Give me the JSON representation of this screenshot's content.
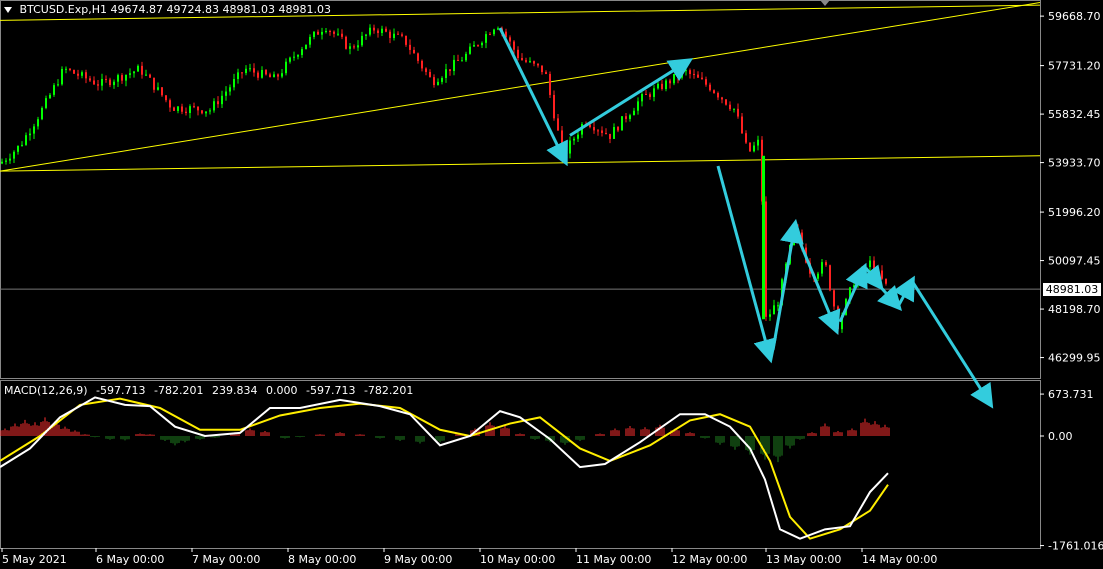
{
  "header": {
    "symbol": "BTCUSD.Exp,H1",
    "open": "49674.87",
    "high": "49724.83",
    "low": "48981.03",
    "close": "48981.03"
  },
  "current_price": "48981.03",
  "macd_header": {
    "name": "MACD(12,26,9)",
    "values": [
      "-597.713",
      "-782.201",
      "239.834",
      "0.000",
      "-597.713",
      "-782.201"
    ]
  },
  "colors": {
    "background": "#000000",
    "bull": "#00ff00",
    "bear": "#ff2020",
    "trendline": "#ffff00",
    "arrow": "#33ccdd",
    "macd_line": "#ffffff",
    "signal_line": "#ffee00",
    "hist_pos": "#ff3030",
    "hist_neg": "#208020",
    "grid_border": "#ffffff"
  },
  "chart_data": [
    {
      "type": "candlestick",
      "title": "BTCUSD.Exp,H1",
      "ylim": [
        45500,
        60300
      ],
      "y_ticks": [
        59668.7,
        57731.2,
        55832.45,
        53933.7,
        51996.2,
        50097.45,
        48198.7,
        46299.95
      ],
      "x_ticks": [
        "5 May 2021",
        "6 May 00:00",
        "7 May 00:00",
        "8 May 00:00",
        "9 May 00:00",
        "10 May 00:00",
        "11 May 00:00",
        "12 May 00:00",
        "13 May 00:00",
        "14 May 00:00"
      ],
      "price_path": [
        {
          "x": 0,
          "y": 53900
        },
        {
          "x": 20,
          "y": 54600
        },
        {
          "x": 45,
          "y": 56200
        },
        {
          "x": 64,
          "y": 57600
        },
        {
          "x": 100,
          "y": 57000
        },
        {
          "x": 140,
          "y": 57600
        },
        {
          "x": 172,
          "y": 56100
        },
        {
          "x": 210,
          "y": 56000
        },
        {
          "x": 245,
          "y": 57600
        },
        {
          "x": 275,
          "y": 57200
        },
        {
          "x": 300,
          "y": 58400
        },
        {
          "x": 325,
          "y": 59300
        },
        {
          "x": 350,
          "y": 58400
        },
        {
          "x": 375,
          "y": 59200
        },
        {
          "x": 405,
          "y": 58700
        },
        {
          "x": 432,
          "y": 57100
        },
        {
          "x": 465,
          "y": 58100
        },
        {
          "x": 497,
          "y": 59400
        },
        {
          "x": 520,
          "y": 58000
        },
        {
          "x": 545,
          "y": 57500
        },
        {
          "x": 563,
          "y": 54200
        },
        {
          "x": 585,
          "y": 55600
        },
        {
          "x": 610,
          "y": 55000
        },
        {
          "x": 640,
          "y": 56400
        },
        {
          "x": 685,
          "y": 57500
        },
        {
          "x": 710,
          "y": 56900
        },
        {
          "x": 735,
          "y": 56000
        },
        {
          "x": 748,
          "y": 54300
        },
        {
          "x": 760,
          "y": 54800
        },
        {
          "x": 766,
          "y": 47800
        },
        {
          "x": 778,
          "y": 48500
        },
        {
          "x": 795,
          "y": 51400
        },
        {
          "x": 812,
          "y": 49500
        },
        {
          "x": 825,
          "y": 50000
        },
        {
          "x": 838,
          "y": 47600
        },
        {
          "x": 855,
          "y": 49400
        },
        {
          "x": 870,
          "y": 50000
        },
        {
          "x": 888,
          "y": 48981
        }
      ],
      "trendlines": [
        {
          "x1": 0,
          "y1": 59500,
          "x2": 1040,
          "y2": 60100
        },
        {
          "x1": 0,
          "y1": 53600,
          "x2": 1040,
          "y2": 60200
        },
        {
          "x1": 0,
          "y1": 53600,
          "x2": 1040,
          "y2": 54200
        }
      ],
      "arrows": [
        {
          "x1": 500,
          "y1": 59200,
          "x2": 565,
          "y2": 54000
        },
        {
          "x1": 570,
          "y1": 55000,
          "x2": 688,
          "y2": 57900
        },
        {
          "x1": 718,
          "y1": 53800,
          "x2": 770,
          "y2": 46300
        },
        {
          "x1": 773,
          "y1": 46600,
          "x2": 795,
          "y2": 51500
        },
        {
          "x1": 798,
          "y1": 51000,
          "x2": 836,
          "y2": 47400
        },
        {
          "x1": 840,
          "y1": 47700,
          "x2": 864,
          "y2": 49800
        },
        {
          "x1": 866,
          "y1": 49800,
          "x2": 880,
          "y2": 49100
        },
        {
          "x1": 882,
          "y1": 49000,
          "x2": 898,
          "y2": 48300
        },
        {
          "x1": 898,
          "y1": 48300,
          "x2": 912,
          "y2": 49300
        },
        {
          "x1": 912,
          "y1": 49300,
          "x2": 990,
          "y2": 44500
        }
      ]
    },
    {
      "type": "line",
      "title": "MACD(12,26,9)",
      "ylim": [
        -1800,
        900
      ],
      "y_ticks": [
        673.731,
        0.0,
        -1761.016
      ],
      "series": [
        {
          "values_xy": [
            [
              0,
              -500
            ],
            [
              30,
              -200
            ],
            [
              60,
              300
            ],
            [
              95,
              620
            ],
            [
              125,
              500
            ],
            [
              150,
              480
            ],
            [
              175,
              150
            ],
            [
              205,
              0
            ],
            [
              240,
              50
            ],
            [
              270,
              450
            ],
            [
              300,
              450
            ],
            [
              340,
              580
            ],
            [
              380,
              480
            ],
            [
              410,
              350
            ],
            [
              440,
              -150
            ],
            [
              470,
              0
            ],
            [
              500,
              400
            ],
            [
              520,
              300
            ],
            [
              550,
              -50
            ],
            [
              580,
              -500
            ],
            [
              605,
              -450
            ],
            [
              640,
              -100
            ],
            [
              680,
              350
            ],
            [
              705,
              350
            ],
            [
              730,
              150
            ],
            [
              750,
              -200
            ],
            [
              765,
              -700
            ],
            [
              780,
              -1500
            ],
            [
              800,
              -1650
            ],
            [
              825,
              -1500
            ],
            [
              850,
              -1450
            ],
            [
              870,
              -900
            ],
            [
              888,
              -597.713
            ]
          ]
        },
        {
          "values_xy": [
            [
              0,
              -400
            ],
            [
              40,
              0
            ],
            [
              80,
              500
            ],
            [
              120,
              600
            ],
            [
              160,
              450
            ],
            [
              200,
              100
            ],
            [
              240,
              100
            ],
            [
              280,
              330
            ],
            [
              320,
              450
            ],
            [
              360,
              520
            ],
            [
              400,
              450
            ],
            [
              440,
              100
            ],
            [
              470,
              0
            ],
            [
              510,
              200
            ],
            [
              540,
              300
            ],
            [
              580,
              -200
            ],
            [
              610,
              -400
            ],
            [
              650,
              -150
            ],
            [
              690,
              250
            ],
            [
              720,
              350
            ],
            [
              750,
              150
            ],
            [
              770,
              -400
            ],
            [
              790,
              -1300
            ],
            [
              810,
              -1650
            ],
            [
              840,
              -1500
            ],
            [
              870,
              -1200
            ],
            [
              888,
              -782.201
            ]
          ]
        }
      ],
      "histogram": [
        {
          "x": 5,
          "v": 120
        },
        {
          "x": 15,
          "v": 200
        },
        {
          "x": 25,
          "v": 260
        },
        {
          "x": 35,
          "v": 220
        },
        {
          "x": 45,
          "v": 300
        },
        {
          "x": 55,
          "v": 240
        },
        {
          "x": 65,
          "v": 150
        },
        {
          "x": 75,
          "v": 90
        },
        {
          "x": 85,
          "v": 30
        },
        {
          "x": 95,
          "v": -20
        },
        {
          "x": 110,
          "v": -60
        },
        {
          "x": 125,
          "v": -70
        },
        {
          "x": 140,
          "v": 40
        },
        {
          "x": 150,
          "v": 30
        },
        {
          "x": 165,
          "v": -80
        },
        {
          "x": 175,
          "v": -150
        },
        {
          "x": 185,
          "v": -100
        },
        {
          "x": 200,
          "v": -60
        },
        {
          "x": 215,
          "v": -30
        },
        {
          "x": 235,
          "v": 60
        },
        {
          "x": 250,
          "v": 120
        },
        {
          "x": 265,
          "v": 80
        },
        {
          "x": 285,
          "v": -40
        },
        {
          "x": 300,
          "v": -20
        },
        {
          "x": 320,
          "v": 30
        },
        {
          "x": 340,
          "v": 60
        },
        {
          "x": 360,
          "v": 30
        },
        {
          "x": 380,
          "v": -40
        },
        {
          "x": 400,
          "v": -80
        },
        {
          "x": 420,
          "v": -120
        },
        {
          "x": 440,
          "v": -100
        },
        {
          "x": 460,
          "v": 40
        },
        {
          "x": 475,
          "v": 120
        },
        {
          "x": 490,
          "v": 220
        },
        {
          "x": 505,
          "v": 160
        },
        {
          "x": 520,
          "v": 40
        },
        {
          "x": 535,
          "v": -60
        },
        {
          "x": 550,
          "v": -100
        },
        {
          "x": 565,
          "v": -140
        },
        {
          "x": 580,
          "v": -80
        },
        {
          "x": 600,
          "v": 40
        },
        {
          "x": 615,
          "v": 120
        },
        {
          "x": 630,
          "v": 160
        },
        {
          "x": 645,
          "v": 140
        },
        {
          "x": 660,
          "v": 180
        },
        {
          "x": 675,
          "v": 120
        },
        {
          "x": 690,
          "v": 60
        },
        {
          "x": 705,
          "v": -40
        },
        {
          "x": 720,
          "v": -140
        },
        {
          "x": 735,
          "v": -220
        },
        {
          "x": 750,
          "v": -300
        },
        {
          "x": 765,
          "v": -380
        },
        {
          "x": 778,
          "v": -420
        },
        {
          "x": 790,
          "v": -200
        },
        {
          "x": 800,
          "v": -60
        },
        {
          "x": 812,
          "v": 60
        },
        {
          "x": 825,
          "v": 200
        },
        {
          "x": 838,
          "v": 80
        },
        {
          "x": 852,
          "v": 120
        },
        {
          "x": 865,
          "v": 280
        },
        {
          "x": 875,
          "v": 240
        },
        {
          "x": 885,
          "v": 180
        }
      ]
    }
  ]
}
